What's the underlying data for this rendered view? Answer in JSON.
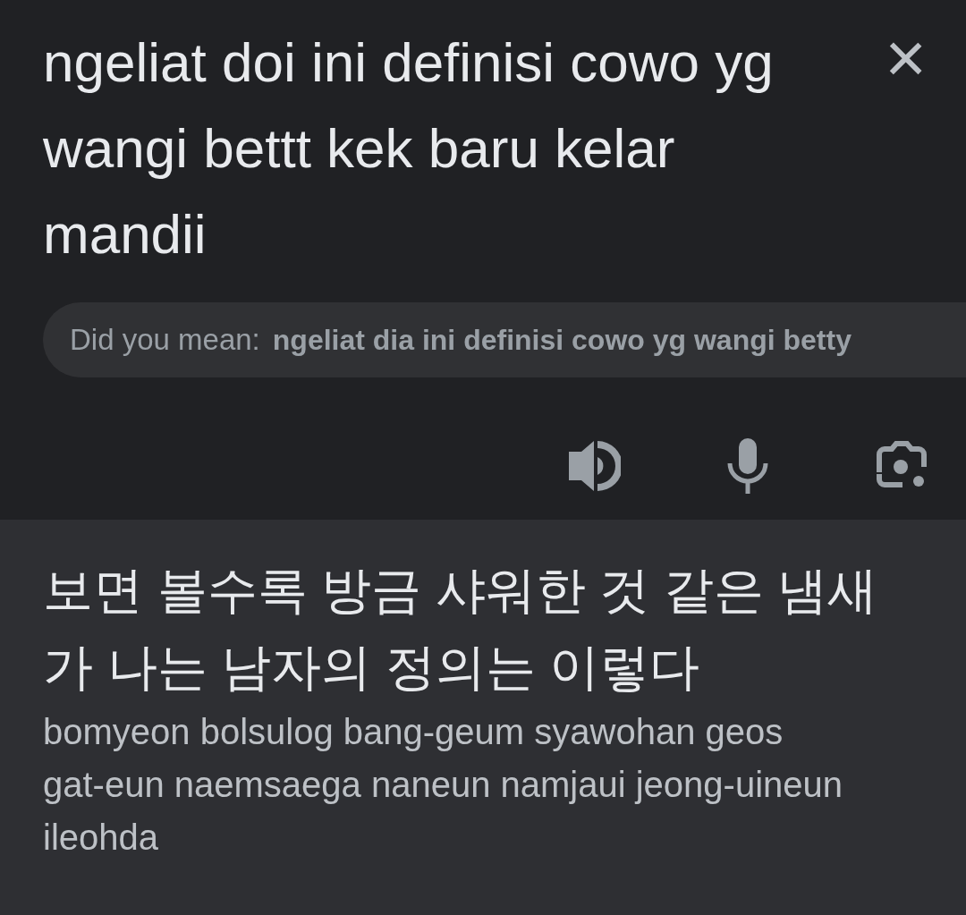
{
  "source": {
    "text": "ngeliat doi ini definisi cowo yg wangi bettt kek baru kelar mandii",
    "close": "×"
  },
  "suggestion": {
    "label": "Did you mean:",
    "text": "ngeliat dia ini definisi cowo yg wangi betty"
  },
  "translation": {
    "text": "보면 볼수록 방금 샤워한 것 같은 냄새가 나는 남자의 정의는 이렇다",
    "romanization": "bomyeon bolsulog bang-geum syawohan geos gat-eun naemsaega naneun namjaui jeong-uineun ileohda"
  }
}
